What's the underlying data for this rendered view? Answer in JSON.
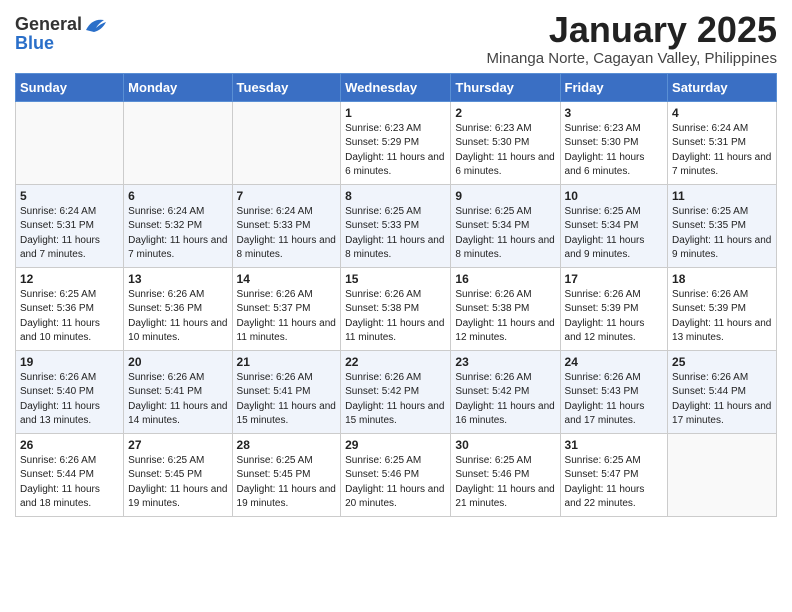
{
  "logo": {
    "general": "General",
    "blue": "Blue"
  },
  "title": "January 2025",
  "subtitle": "Minanga Norte, Cagayan Valley, Philippines",
  "days_of_week": [
    "Sunday",
    "Monday",
    "Tuesday",
    "Wednesday",
    "Thursday",
    "Friday",
    "Saturday"
  ],
  "weeks": [
    [
      {
        "day": "",
        "sunrise": "",
        "sunset": "",
        "daylight": ""
      },
      {
        "day": "",
        "sunrise": "",
        "sunset": "",
        "daylight": ""
      },
      {
        "day": "",
        "sunrise": "",
        "sunset": "",
        "daylight": ""
      },
      {
        "day": "1",
        "sunrise": "Sunrise: 6:23 AM",
        "sunset": "Sunset: 5:29 PM",
        "daylight": "Daylight: 11 hours and 6 minutes."
      },
      {
        "day": "2",
        "sunrise": "Sunrise: 6:23 AM",
        "sunset": "Sunset: 5:30 PM",
        "daylight": "Daylight: 11 hours and 6 minutes."
      },
      {
        "day": "3",
        "sunrise": "Sunrise: 6:23 AM",
        "sunset": "Sunset: 5:30 PM",
        "daylight": "Daylight: 11 hours and 6 minutes."
      },
      {
        "day": "4",
        "sunrise": "Sunrise: 6:24 AM",
        "sunset": "Sunset: 5:31 PM",
        "daylight": "Daylight: 11 hours and 7 minutes."
      }
    ],
    [
      {
        "day": "5",
        "sunrise": "Sunrise: 6:24 AM",
        "sunset": "Sunset: 5:31 PM",
        "daylight": "Daylight: 11 hours and 7 minutes."
      },
      {
        "day": "6",
        "sunrise": "Sunrise: 6:24 AM",
        "sunset": "Sunset: 5:32 PM",
        "daylight": "Daylight: 11 hours and 7 minutes."
      },
      {
        "day": "7",
        "sunrise": "Sunrise: 6:24 AM",
        "sunset": "Sunset: 5:33 PM",
        "daylight": "Daylight: 11 hours and 8 minutes."
      },
      {
        "day": "8",
        "sunrise": "Sunrise: 6:25 AM",
        "sunset": "Sunset: 5:33 PM",
        "daylight": "Daylight: 11 hours and 8 minutes."
      },
      {
        "day": "9",
        "sunrise": "Sunrise: 6:25 AM",
        "sunset": "Sunset: 5:34 PM",
        "daylight": "Daylight: 11 hours and 8 minutes."
      },
      {
        "day": "10",
        "sunrise": "Sunrise: 6:25 AM",
        "sunset": "Sunset: 5:34 PM",
        "daylight": "Daylight: 11 hours and 9 minutes."
      },
      {
        "day": "11",
        "sunrise": "Sunrise: 6:25 AM",
        "sunset": "Sunset: 5:35 PM",
        "daylight": "Daylight: 11 hours and 9 minutes."
      }
    ],
    [
      {
        "day": "12",
        "sunrise": "Sunrise: 6:25 AM",
        "sunset": "Sunset: 5:36 PM",
        "daylight": "Daylight: 11 hours and 10 minutes."
      },
      {
        "day": "13",
        "sunrise": "Sunrise: 6:26 AM",
        "sunset": "Sunset: 5:36 PM",
        "daylight": "Daylight: 11 hours and 10 minutes."
      },
      {
        "day": "14",
        "sunrise": "Sunrise: 6:26 AM",
        "sunset": "Sunset: 5:37 PM",
        "daylight": "Daylight: 11 hours and 11 minutes."
      },
      {
        "day": "15",
        "sunrise": "Sunrise: 6:26 AM",
        "sunset": "Sunset: 5:38 PM",
        "daylight": "Daylight: 11 hours and 11 minutes."
      },
      {
        "day": "16",
        "sunrise": "Sunrise: 6:26 AM",
        "sunset": "Sunset: 5:38 PM",
        "daylight": "Daylight: 11 hours and 12 minutes."
      },
      {
        "day": "17",
        "sunrise": "Sunrise: 6:26 AM",
        "sunset": "Sunset: 5:39 PM",
        "daylight": "Daylight: 11 hours and 12 minutes."
      },
      {
        "day": "18",
        "sunrise": "Sunrise: 6:26 AM",
        "sunset": "Sunset: 5:39 PM",
        "daylight": "Daylight: 11 hours and 13 minutes."
      }
    ],
    [
      {
        "day": "19",
        "sunrise": "Sunrise: 6:26 AM",
        "sunset": "Sunset: 5:40 PM",
        "daylight": "Daylight: 11 hours and 13 minutes."
      },
      {
        "day": "20",
        "sunrise": "Sunrise: 6:26 AM",
        "sunset": "Sunset: 5:41 PM",
        "daylight": "Daylight: 11 hours and 14 minutes."
      },
      {
        "day": "21",
        "sunrise": "Sunrise: 6:26 AM",
        "sunset": "Sunset: 5:41 PM",
        "daylight": "Daylight: 11 hours and 15 minutes."
      },
      {
        "day": "22",
        "sunrise": "Sunrise: 6:26 AM",
        "sunset": "Sunset: 5:42 PM",
        "daylight": "Daylight: 11 hours and 15 minutes."
      },
      {
        "day": "23",
        "sunrise": "Sunrise: 6:26 AM",
        "sunset": "Sunset: 5:42 PM",
        "daylight": "Daylight: 11 hours and 16 minutes."
      },
      {
        "day": "24",
        "sunrise": "Sunrise: 6:26 AM",
        "sunset": "Sunset: 5:43 PM",
        "daylight": "Daylight: 11 hours and 17 minutes."
      },
      {
        "day": "25",
        "sunrise": "Sunrise: 6:26 AM",
        "sunset": "Sunset: 5:44 PM",
        "daylight": "Daylight: 11 hours and 17 minutes."
      }
    ],
    [
      {
        "day": "26",
        "sunrise": "Sunrise: 6:26 AM",
        "sunset": "Sunset: 5:44 PM",
        "daylight": "Daylight: 11 hours and 18 minutes."
      },
      {
        "day": "27",
        "sunrise": "Sunrise: 6:25 AM",
        "sunset": "Sunset: 5:45 PM",
        "daylight": "Daylight: 11 hours and 19 minutes."
      },
      {
        "day": "28",
        "sunrise": "Sunrise: 6:25 AM",
        "sunset": "Sunset: 5:45 PM",
        "daylight": "Daylight: 11 hours and 19 minutes."
      },
      {
        "day": "29",
        "sunrise": "Sunrise: 6:25 AM",
        "sunset": "Sunset: 5:46 PM",
        "daylight": "Daylight: 11 hours and 20 minutes."
      },
      {
        "day": "30",
        "sunrise": "Sunrise: 6:25 AM",
        "sunset": "Sunset: 5:46 PM",
        "daylight": "Daylight: 11 hours and 21 minutes."
      },
      {
        "day": "31",
        "sunrise": "Sunrise: 6:25 AM",
        "sunset": "Sunset: 5:47 PM",
        "daylight": "Daylight: 11 hours and 22 minutes."
      },
      {
        "day": "",
        "sunrise": "",
        "sunset": "",
        "daylight": ""
      }
    ]
  ]
}
